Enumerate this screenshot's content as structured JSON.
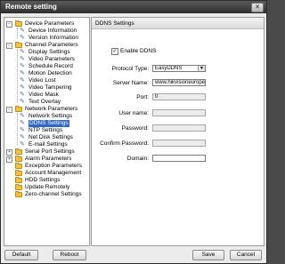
{
  "window": {
    "title": "Remote setting",
    "close_glyph": "✕"
  },
  "tree": {
    "groups": [
      {
        "label": "Device Parameters",
        "toggle": "−",
        "children": [
          "Device Information",
          "Version Information"
        ]
      },
      {
        "label": "Channel Parameters",
        "toggle": "−",
        "children": [
          "Display Settings",
          "Video Parameters",
          "Schedule Record",
          "Motion Detection",
          "Video Lost",
          "Video Tampering",
          "Video Mask",
          "Text Overlay"
        ]
      },
      {
        "label": "Network Parameters",
        "toggle": "−",
        "children": [
          "Network Settings",
          "DDNS Settings",
          "NTP Settings",
          "Net Disk Settings",
          "E-mail Settings"
        ]
      },
      {
        "label": "Serial Port Settings",
        "toggle": "+"
      },
      {
        "label": "Alarm Parameters",
        "toggle": "+"
      },
      {
        "label": "Exception Parameters"
      },
      {
        "label": "Account Management"
      },
      {
        "label": "HDD Settings"
      },
      {
        "label": "Update Remotely"
      },
      {
        "label": "Zero-channel Settings"
      }
    ],
    "selected": "DDNS Settings"
  },
  "panel": {
    "title": "DDNS Settings",
    "enable_label": "Enable DDNS",
    "enable_checked": "✓",
    "protocol_label": "Protocol Type:",
    "protocol_value": "EasyDDNS",
    "server_label": "Server Name:",
    "server_value": "www.hikvisioneurope",
    "port_label": "Port:",
    "port_value": "0",
    "user_label": "User name:",
    "user_value": "",
    "password_label": "Password:",
    "password_value": "",
    "confirm_label": "Confirm Password:",
    "confirm_value": "",
    "domain_label": "Domain:",
    "domain_value": ""
  },
  "buttons": {
    "default": "Default",
    "reboot": "Reboot",
    "save": "Save",
    "cancel": "Cancel"
  }
}
